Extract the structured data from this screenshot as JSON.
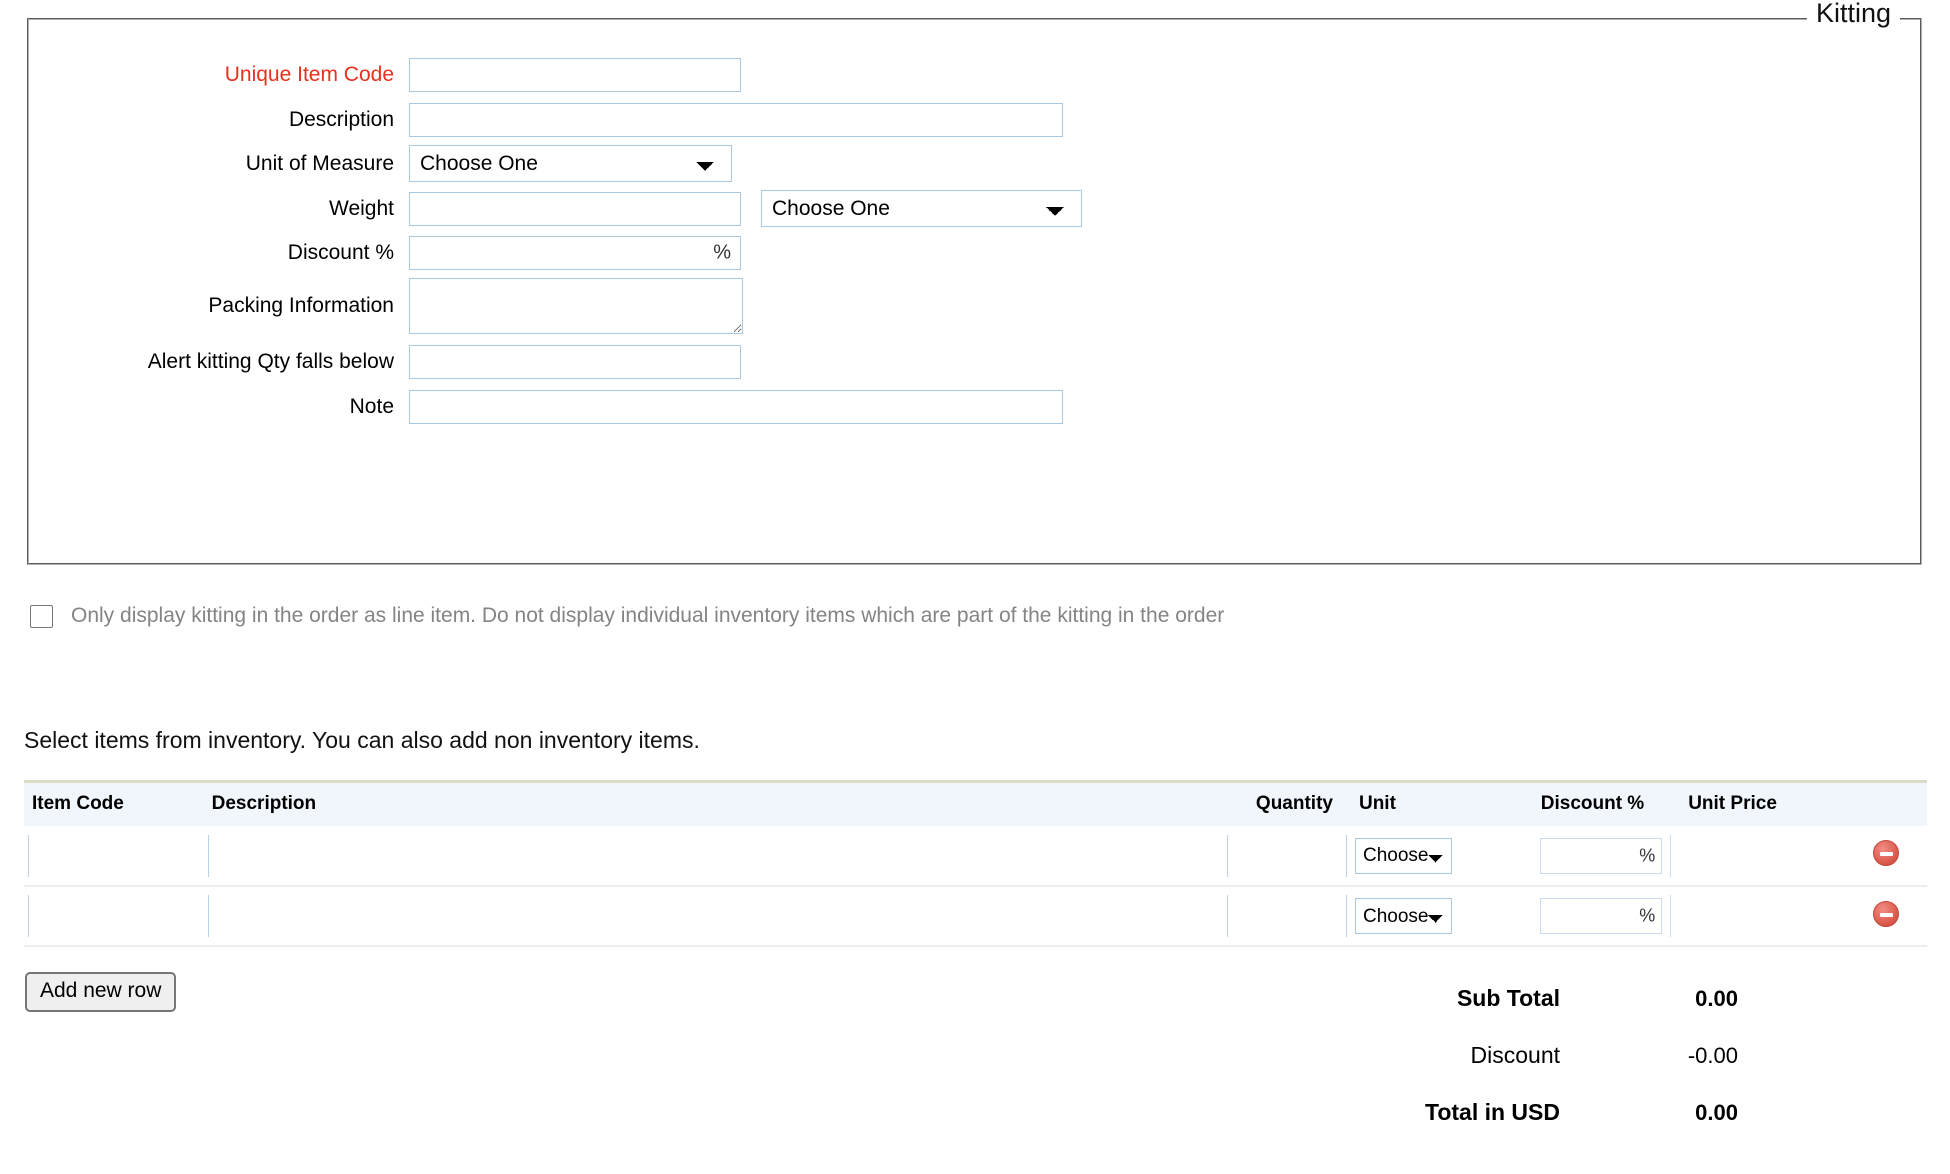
{
  "fieldset": {
    "legend": "Kitting",
    "fields": [
      {
        "label": "Unique Item Code",
        "required": true,
        "type": "text",
        "value": "",
        "placeholder": ""
      },
      {
        "label": "Description",
        "required": false,
        "type": "text",
        "value": "",
        "placeholder": ""
      },
      {
        "label": "Unit of Measure",
        "required": false,
        "type": "select",
        "value": "Choose One",
        "options": [
          "Choose One"
        ]
      },
      {
        "label": "Weight",
        "required": false,
        "type": "text+select",
        "value": "",
        "unit_value": "Choose One",
        "unit_options": [
          "Choose One"
        ]
      },
      {
        "label": "Discount %",
        "required": false,
        "type": "percent",
        "value": "",
        "suffix": "%"
      },
      {
        "label": "Packing Information",
        "required": false,
        "type": "textarea",
        "value": "",
        "placeholder": ""
      },
      {
        "label": "Alert kitting Qty falls below",
        "required": false,
        "type": "text",
        "value": "",
        "placeholder": ""
      },
      {
        "label": "Note",
        "required": false,
        "type": "text",
        "value": "",
        "placeholder": ""
      }
    ]
  },
  "options": {
    "only_display_kitting": {
      "checked": false,
      "label": "Only display kitting in the order as line item. Do not display individual inventory items which are part of the kitting in the order"
    }
  },
  "items_section": {
    "intro": "Select items from inventory. You can also add non inventory items.",
    "columns": [
      "Item Code",
      "Description",
      "Quantity",
      "Unit",
      "Discount %",
      "Unit Price",
      ""
    ],
    "rows": [
      {
        "item_code": "",
        "description": "",
        "quantity": "",
        "unit": "Choose",
        "unit_options": [
          "Choose"
        ],
        "discount": "",
        "discount_suffix": "%",
        "unit_price": "",
        "remove_icon": "remove-circle-icon"
      },
      {
        "item_code": "",
        "description": "",
        "quantity": "",
        "unit": "Choose",
        "unit_options": [
          "Choose"
        ],
        "discount": "",
        "discount_suffix": "%",
        "unit_price": "",
        "remove_icon": "remove-circle-icon"
      }
    ],
    "add_row_label": "Add new row"
  },
  "totals": [
    {
      "label": "Sub Total",
      "value": "0.00",
      "bold": true
    },
    {
      "label": "Discount",
      "value": "-0.00",
      "bold": false
    },
    {
      "label": "Total in USD",
      "value": "0.00",
      "bold": true
    }
  ],
  "colors": {
    "required_label": "#e8301c",
    "input_border": "#a9c9e2",
    "table_header_bg": "#f1f6fd",
    "table_top_border": "#dcdcc6",
    "muted_text": "#848484",
    "remove_icon": "#d1503f"
  }
}
